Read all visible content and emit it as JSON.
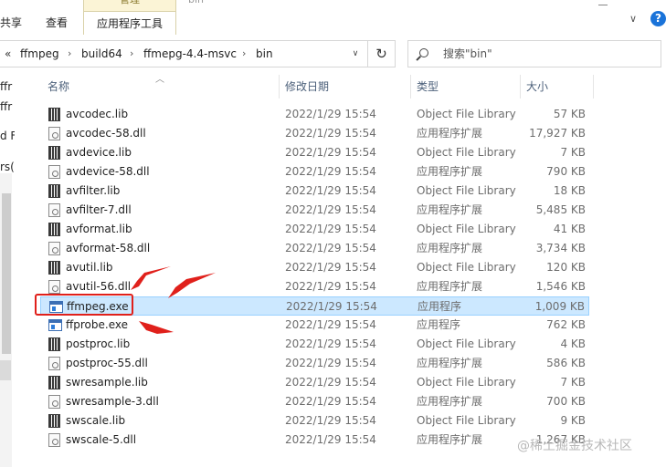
{
  "ribbon": {
    "tabs": [
      "共享",
      "查看"
    ],
    "context_group": "管理",
    "context_tab": "应用程序工具",
    "title_fragment": "bin",
    "help": "?"
  },
  "address": {
    "prev": "«",
    "crumbs": [
      "ffmpeg",
      "build64",
      "ffmepg-4.4-msvc",
      "bin"
    ],
    "separator": "›",
    "dropdown": "∨",
    "refresh": "↻",
    "search_placeholder": "搜索\"bin\""
  },
  "nav_pane": {
    "items": [
      "ffr",
      "ffr",
      "d F",
      "rs("
    ]
  },
  "columns": {
    "name": "名称",
    "date": "修改日期",
    "type": "类型",
    "size": "大小"
  },
  "files": [
    {
      "name": "avcodec.lib",
      "icon": "lib-file-icon",
      "date": "2022/1/29 15:54",
      "type": "Object File Library",
      "size": "57 KB"
    },
    {
      "name": "avcodec-58.dll",
      "icon": "dll-file-icon",
      "date": "2022/1/29 15:54",
      "type": "应用程序扩展",
      "size": "17,927 KB"
    },
    {
      "name": "avdevice.lib",
      "icon": "lib-file-icon",
      "date": "2022/1/29 15:54",
      "type": "Object File Library",
      "size": "7 KB"
    },
    {
      "name": "avdevice-58.dll",
      "icon": "dll-file-icon",
      "date": "2022/1/29 15:54",
      "type": "应用程序扩展",
      "size": "790 KB"
    },
    {
      "name": "avfilter.lib",
      "icon": "lib-file-icon",
      "date": "2022/1/29 15:54",
      "type": "Object File Library",
      "size": "18 KB"
    },
    {
      "name": "avfilter-7.dll",
      "icon": "dll-file-icon",
      "date": "2022/1/29 15:54",
      "type": "应用程序扩展",
      "size": "5,485 KB"
    },
    {
      "name": "avformat.lib",
      "icon": "lib-file-icon",
      "date": "2022/1/29 15:54",
      "type": "Object File Library",
      "size": "41 KB"
    },
    {
      "name": "avformat-58.dll",
      "icon": "dll-file-icon",
      "date": "2022/1/29 15:54",
      "type": "应用程序扩展",
      "size": "3,734 KB"
    },
    {
      "name": "avutil.lib",
      "icon": "lib-file-icon",
      "date": "2022/1/29 15:54",
      "type": "Object File Library",
      "size": "120 KB"
    },
    {
      "name": "avutil-56.dll",
      "icon": "dll-file-icon",
      "date": "2022/1/29 15:54",
      "type": "应用程序扩展",
      "size": "1,546 KB"
    },
    {
      "name": "ffmpeg.exe",
      "icon": "exe-file-icon",
      "date": "2022/1/29 15:54",
      "type": "应用程序",
      "size": "1,009 KB",
      "selected": true
    },
    {
      "name": "ffprobe.exe",
      "icon": "exe-file-icon",
      "date": "2022/1/29 15:54",
      "type": "应用程序",
      "size": "762 KB"
    },
    {
      "name": "postproc.lib",
      "icon": "lib-file-icon",
      "date": "2022/1/29 15:54",
      "type": "Object File Library",
      "size": "4 KB"
    },
    {
      "name": "postproc-55.dll",
      "icon": "dll-file-icon",
      "date": "2022/1/29 15:54",
      "type": "应用程序扩展",
      "size": "586 KB"
    },
    {
      "name": "swresample.lib",
      "icon": "lib-file-icon",
      "date": "2022/1/29 15:54",
      "type": "Object File Library",
      "size": "7 KB"
    },
    {
      "name": "swresample-3.dll",
      "icon": "dll-file-icon",
      "date": "2022/1/29 15:54",
      "type": "应用程序扩展",
      "size": "700 KB"
    },
    {
      "name": "swscale.lib",
      "icon": "lib-file-icon",
      "date": "2022/1/29 15:54",
      "type": "Object File Library",
      "size": "9 KB"
    },
    {
      "name": "swscale-5.dll",
      "icon": "dll-file-icon",
      "date": "2022/1/29 15:54",
      "type": "应用程序扩展",
      "size": "1,267 KB"
    }
  ],
  "colors": {
    "selected_row": "#cce8ff",
    "annotation_red": "#e0201b",
    "context_tab_bg": "#fbf4d6"
  },
  "watermark": "@稀土掘金技术社区"
}
